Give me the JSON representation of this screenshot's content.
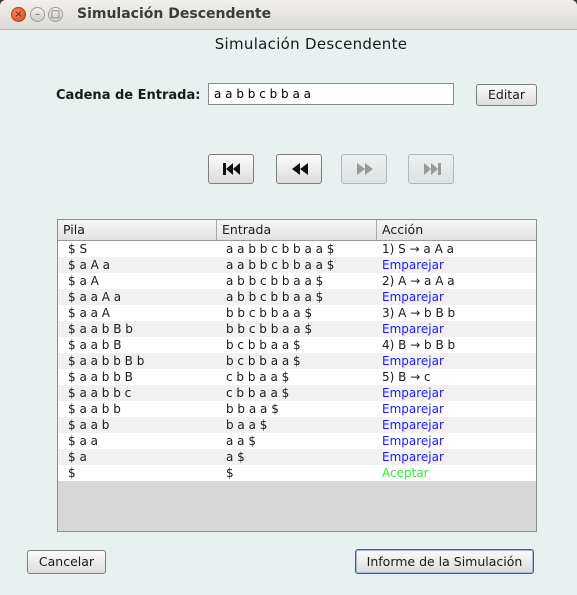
{
  "window": {
    "title": "Simulación Descendente",
    "controls": {
      "close": "×",
      "minimize": "–",
      "maximize": "□"
    }
  },
  "heading": "Simulación Descendente",
  "input": {
    "label": "Cadena de Entrada:",
    "value": "a a b b c b b a a",
    "edit_label": "Editar"
  },
  "nav_buttons": [
    {
      "name": "first-button",
      "icon": "skip-first-icon",
      "enabled": true
    },
    {
      "name": "previous-button",
      "icon": "rewind-icon",
      "enabled": true
    },
    {
      "name": "next-button",
      "icon": "fast-forward-icon",
      "enabled": false
    },
    {
      "name": "last-button",
      "icon": "skip-last-icon",
      "enabled": false
    }
  ],
  "table": {
    "headers": [
      "Pila",
      "Entrada",
      "Acción"
    ],
    "rows": [
      {
        "pila": "$ S",
        "entrada": "a a b b c b b a a $",
        "accion": "1) S → a A a",
        "kind": "rule"
      },
      {
        "pila": "$ a A a",
        "entrada": "a a b b c b b a a $",
        "accion": "Emparejar",
        "kind": "match"
      },
      {
        "pila": "$ a A",
        "entrada": "a b b c b b a a $",
        "accion": "2) A → a A a",
        "kind": "rule"
      },
      {
        "pila": "$ a a A a",
        "entrada": "a b b c b b a a $",
        "accion": "Emparejar",
        "kind": "match"
      },
      {
        "pila": "$ a a A",
        "entrada": "b b c b b a a $",
        "accion": "3) A → b B b",
        "kind": "rule"
      },
      {
        "pila": "$ a a b B b",
        "entrada": "b b c b b a a $",
        "accion": "Emparejar",
        "kind": "match"
      },
      {
        "pila": "$ a a b B",
        "entrada": "b c b b a a $",
        "accion": "4) B → b B b",
        "kind": "rule"
      },
      {
        "pila": "$ a a b b B b",
        "entrada": "b c b b a a $",
        "accion": "Emparejar",
        "kind": "match"
      },
      {
        "pila": "$ a a b b B",
        "entrada": "c b b a a $",
        "accion": "5) B → c",
        "kind": "rule"
      },
      {
        "pila": "$ a a b b c",
        "entrada": "c b b a a $",
        "accion": "Emparejar",
        "kind": "match"
      },
      {
        "pila": "$ a a b b",
        "entrada": "b b a a $",
        "accion": "Emparejar",
        "kind": "match"
      },
      {
        "pila": "$ a a b",
        "entrada": "b a a $",
        "accion": "Emparejar",
        "kind": "match"
      },
      {
        "pila": "$ a a",
        "entrada": "a a $",
        "accion": "Emparejar",
        "kind": "match"
      },
      {
        "pila": "$ a",
        "entrada": "a $",
        "accion": "Emparejar",
        "kind": "match"
      },
      {
        "pila": "$",
        "entrada": "$",
        "accion": "Aceptar",
        "kind": "accept"
      }
    ]
  },
  "footer": {
    "cancel_label": "Cancelar",
    "report_label": "Informe de la Simulación"
  },
  "colors": {
    "match": "#1a1aff",
    "accept": "#33ee33",
    "background": "#e8f0f0"
  }
}
